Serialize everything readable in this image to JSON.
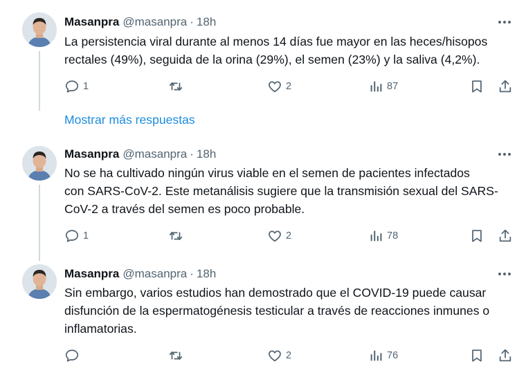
{
  "tweets": [
    {
      "name": "Masanpra",
      "handle": "@masanpra",
      "separator": "·",
      "time": "18h",
      "text_lines": [
        "La persistencia viral durante al menos 14 días fue mayor en las heces/hisopos",
        "rectales (49%), seguida de la orina (29%), el semen (23%) y la saliva (4,2%)."
      ],
      "replies": "1",
      "likes": "2",
      "views": "87"
    },
    {
      "name": "Masanpra",
      "handle": "@masanpra",
      "separator": "·",
      "time": "18h",
      "text_lines": [
        "No se ha cultivado ningún virus viable en el semen de pacientes infectados",
        "con SARS-CoV-2. Este metanálisis sugiere que la transmisión sexual del SARS-",
        "CoV-2 a través del semen es poco probable."
      ],
      "replies": "1",
      "likes": "2",
      "views": "78"
    },
    {
      "name": "Masanpra",
      "handle": "@masanpra",
      "separator": "·",
      "time": "18h",
      "text_lines": [
        "Sin embargo, varios estudios han demostrado que el COVID-19 puede causar",
        "disfunción de la espermatogénesis testicular a través de reacciones inmunes o",
        "inflamatorias."
      ],
      "replies": "",
      "likes": "2",
      "views": "76"
    }
  ],
  "show_more_label": "Mostrar más respuestas",
  "colors": {
    "text": "#0f1419",
    "muted": "#536471",
    "link": "#1d8ce0",
    "thread_line": "#cfd9de"
  },
  "icons": [
    "reply-icon",
    "retweet-icon",
    "like-icon",
    "views-icon",
    "bookmark-icon",
    "share-icon",
    "more-icon"
  ]
}
